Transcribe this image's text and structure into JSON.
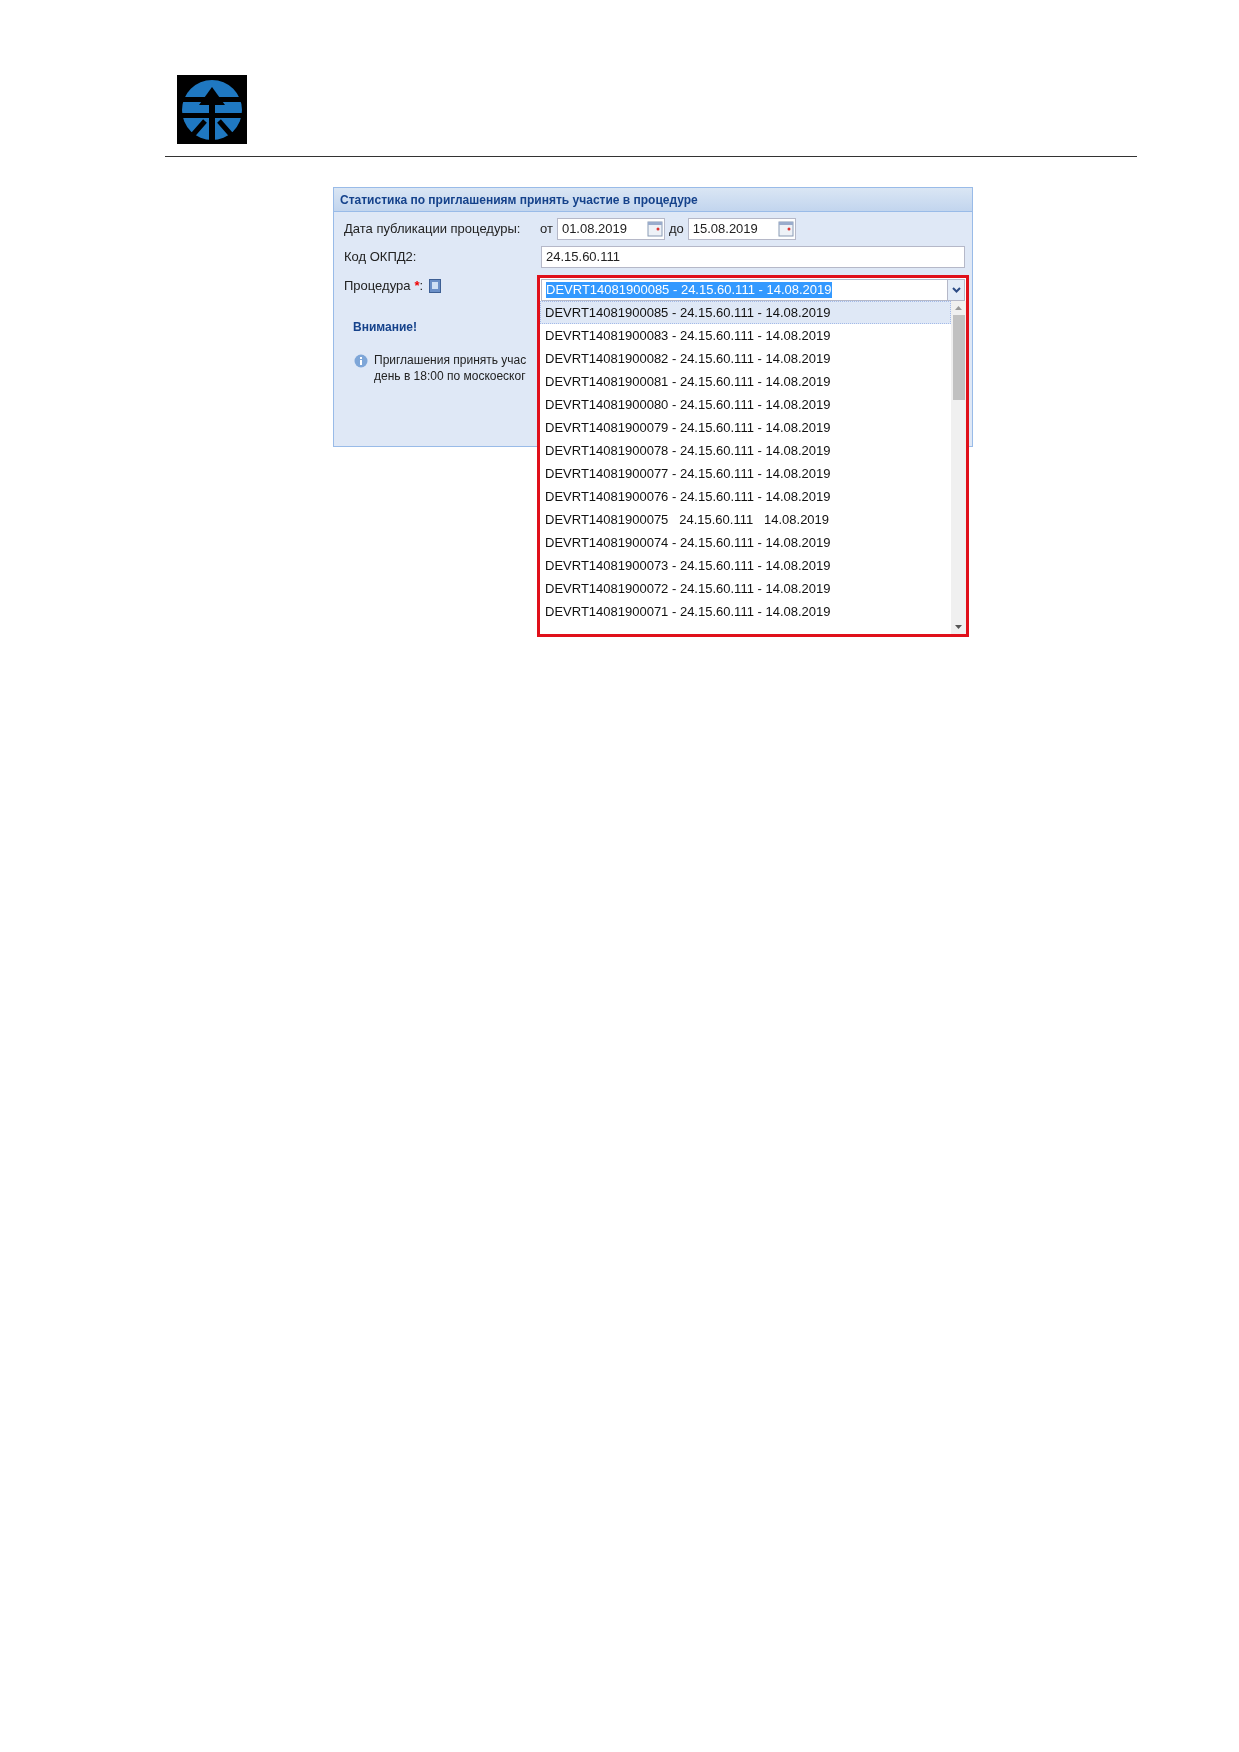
{
  "panel": {
    "title": "Статистика по приглашениям принять участие в процедуре",
    "date_label": "Дата публикации процедуры:",
    "from_label": "от",
    "from_value": "01.08.2019",
    "to_label": "до",
    "to_value": "15.08.2019",
    "okpd_label": "Код ОКПД2:",
    "okpd_value": "24.15.60.111",
    "procedure_label": "Процедура",
    "required_mark": "*",
    "colon": ":",
    "warning_title": "Внимание!",
    "warning_lines": [
      "Приглашения принять учас",
      "день в 18:00 по москоеског"
    ]
  },
  "dropdown": {
    "value": "DEVRT14081900085 - 24.15.60.111 - 14.08.2019",
    "expanded": true,
    "options": [
      {
        "label": "DEVRT14081900085 - 24.15.60.111 - 14.08.2019",
        "selected": true
      },
      {
        "label": "DEVRT14081900083 - 24.15.60.111 - 14.08.2019",
        "selected": false
      },
      {
        "label": "DEVRT14081900082 - 24.15.60.111 - 14.08.2019",
        "selected": false
      },
      {
        "label": "DEVRT14081900081 - 24.15.60.111 - 14.08.2019",
        "selected": false
      },
      {
        "label": "DEVRT14081900080 - 24.15.60.111 - 14.08.2019",
        "selected": false
      },
      {
        "label": "DEVRT14081900079 - 24.15.60.111 - 14.08.2019",
        "selected": false
      },
      {
        "label": "DEVRT14081900078 - 24.15.60.111 - 14.08.2019",
        "selected": false
      },
      {
        "label": "DEVRT14081900077 - 24.15.60.111 - 14.08.2019",
        "selected": false
      },
      {
        "label": "DEVRT14081900076 - 24.15.60.111 - 14.08.2019",
        "selected": false
      },
      {
        "label": "DEVRT14081900075   24.15.60.111   14.08.2019",
        "selected": false
      },
      {
        "label": "DEVRT14081900074 - 24.15.60.111 - 14.08.2019",
        "selected": false
      },
      {
        "label": "DEVRT14081900073 - 24.15.60.111 - 14.08.2019",
        "selected": false
      },
      {
        "label": "DEVRT14081900072 - 24.15.60.111 - 14.08.2019",
        "selected": false
      },
      {
        "label": "DEVRT14081900071 - 24.15.60.111 - 14.08.2019",
        "selected": false
      }
    ]
  }
}
